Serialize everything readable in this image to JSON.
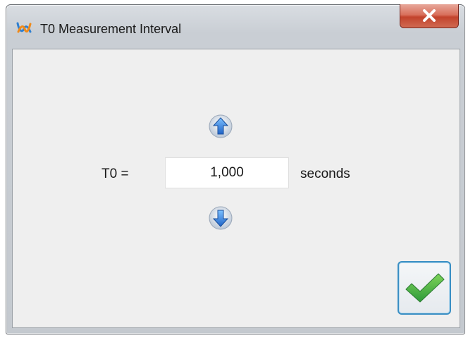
{
  "window": {
    "title": "T0 Measurement Interval",
    "app_icon": "app-logo-icon",
    "close_icon": "close-icon",
    "close_color": "#c9452f"
  },
  "measurement": {
    "label": "T0 =",
    "value": "1,000",
    "unit": "seconds",
    "increase_icon": "arrow-up-icon",
    "decrease_icon": "arrow-down-icon"
  },
  "actions": {
    "confirm_icon": "checkmark-icon",
    "confirm_color": "#43b04a"
  }
}
